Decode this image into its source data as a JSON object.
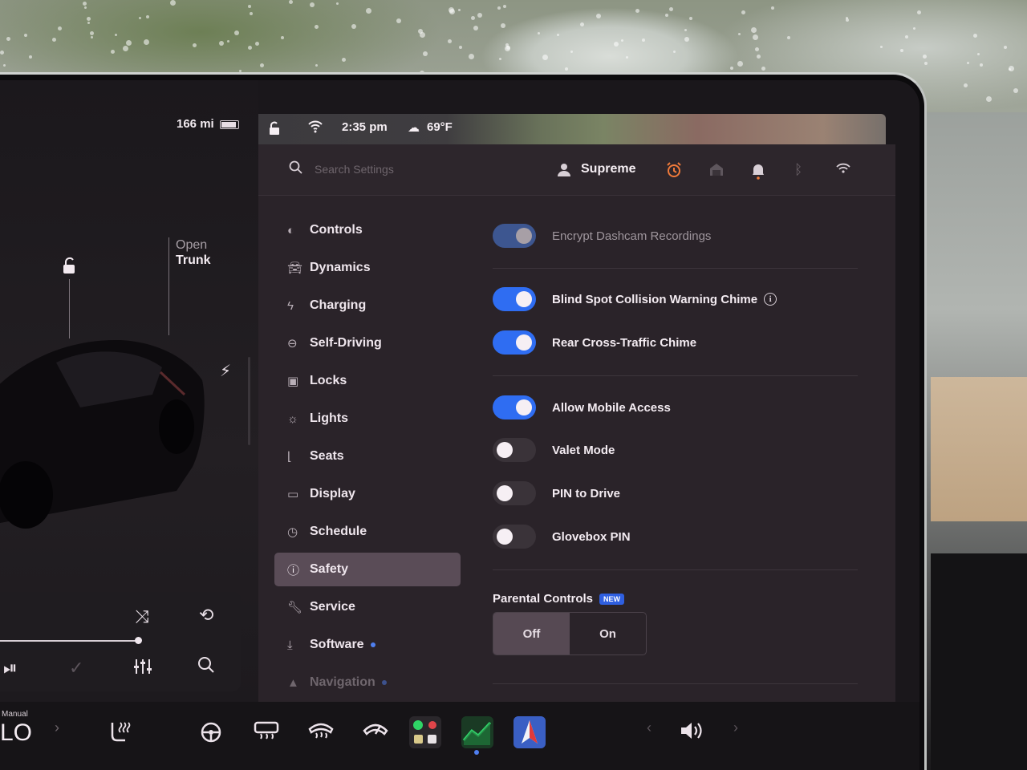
{
  "vehicle": {
    "range": "166 mi",
    "trunk_label_top": "Open",
    "trunk_label_bottom": "Trunk"
  },
  "status_bar": {
    "time": "2:35 pm",
    "temperature": "69°F"
  },
  "header": {
    "search_placeholder": "Search Settings",
    "profile_name": "Supreme"
  },
  "sidebar": {
    "items": [
      {
        "label": "Controls",
        "icon": "toggle-icon"
      },
      {
        "label": "Dynamics",
        "icon": "car-icon"
      },
      {
        "label": "Charging",
        "icon": "bolt-icon"
      },
      {
        "label": "Self-Driving",
        "icon": "steering-wheel-icon"
      },
      {
        "label": "Locks",
        "icon": "lock-icon"
      },
      {
        "label": "Lights",
        "icon": "sun-icon"
      },
      {
        "label": "Seats",
        "icon": "seat-icon"
      },
      {
        "label": "Display",
        "icon": "display-icon"
      },
      {
        "label": "Schedule",
        "icon": "clock-icon"
      },
      {
        "label": "Safety",
        "icon": "alert-icon",
        "active": true
      },
      {
        "label": "Service",
        "icon": "wrench-icon"
      },
      {
        "label": "Software",
        "icon": "download-icon",
        "dot": true
      },
      {
        "label": "Navigation",
        "icon": "navigation-icon",
        "dot": true
      }
    ]
  },
  "safety": {
    "encrypt_dashcam": {
      "label": "Encrypt Dashcam Recordings",
      "on": true,
      "disabled": true
    },
    "blind_spot_chime": {
      "label": "Blind Spot Collision Warning Chime",
      "on": true
    },
    "rear_cross_traffic": {
      "label": "Rear Cross-Traffic Chime",
      "on": true
    },
    "mobile_access": {
      "label": "Allow Mobile Access",
      "on": true
    },
    "valet_mode": {
      "label": "Valet Mode",
      "on": false
    },
    "pin_to_drive": {
      "label": "PIN to Drive",
      "on": false
    },
    "glovebox_pin": {
      "label": "Glovebox PIN",
      "on": false
    },
    "parental_controls": {
      "title": "Parental Controls",
      "badge": "NEW",
      "options": [
        "Off",
        "On"
      ],
      "selected": "Off"
    }
  },
  "dock": {
    "climate_mode": "Manual",
    "temperature": "LO"
  },
  "colors": {
    "accent_blue": "#2f6df2",
    "alarm_orange": "#f07a3a",
    "panel_bg": "#2a2329"
  }
}
